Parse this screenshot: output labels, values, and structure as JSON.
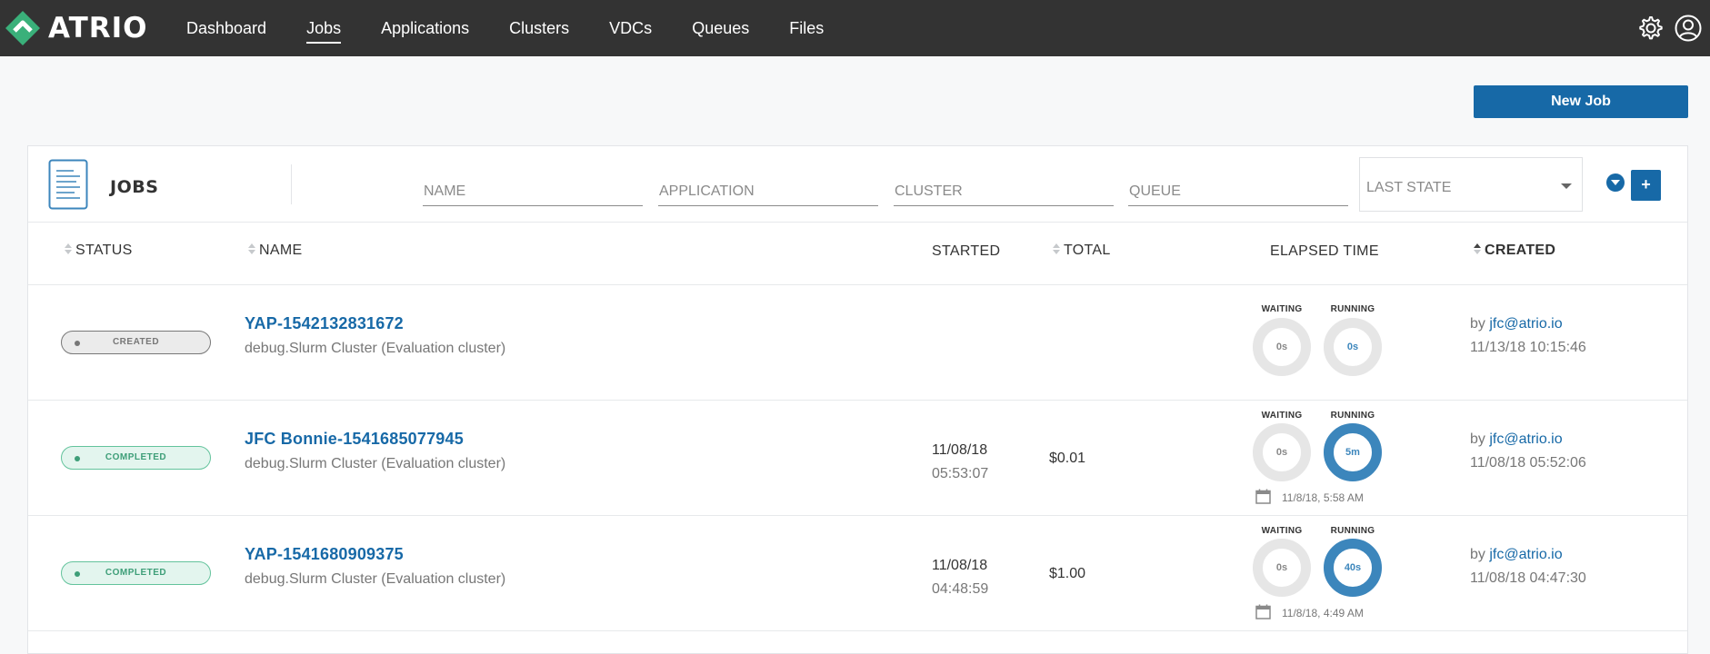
{
  "nav": {
    "logo_text": "ATRIO",
    "links": [
      "Dashboard",
      "Jobs",
      "Applications",
      "Clusters",
      "VDCs",
      "Queues",
      "Files"
    ],
    "active": "Jobs",
    "icons": [
      "gear-icon",
      "user-icon"
    ]
  },
  "actions": {
    "new_job_label": "New Job"
  },
  "jobs_panel": {
    "title": "JOBS",
    "filters": {
      "name_placeholder": "NAME",
      "application_placeholder": "APPLICATION",
      "cluster_placeholder": "CLUSTER",
      "queue_placeholder": "QUEUE",
      "state_placeholder": "LAST STATE"
    },
    "add_button": "+"
  },
  "table": {
    "headers": {
      "status": "STATUS",
      "name": "NAME",
      "started": "STARTED",
      "total": "TOTAL",
      "elapsed": "ELAPSED TIME",
      "created": "CREATED"
    },
    "gauge_labels": {
      "waiting": "WAITING",
      "running": "RUNNING"
    },
    "rows": [
      {
        "status": "CREATED",
        "name": "YAP-1542132831672",
        "subtitle": "debug.Slurm Cluster (Evaluation cluster)",
        "started_date": "",
        "started_time": "",
        "total": "",
        "waiting": "0s",
        "running": "0s",
        "running_active": false,
        "end_time": "",
        "created_by_prefix": "by",
        "created_by": "jfc@atrio.io",
        "created_at": "11/13/18 10:15:46"
      },
      {
        "status": "COMPLETED",
        "name": "JFC Bonnie-1541685077945",
        "subtitle": "debug.Slurm Cluster (Evaluation cluster)",
        "started_date": "11/08/18",
        "started_time": "05:53:07",
        "total": "$0.01",
        "waiting": "0s",
        "running": "5m",
        "running_active": true,
        "end_time": "11/8/18, 5:58 AM",
        "created_by_prefix": "by",
        "created_by": "jfc@atrio.io",
        "created_at": "11/08/18 05:52:06"
      },
      {
        "status": "COMPLETED",
        "name": "YAP-1541680909375",
        "subtitle": "debug.Slurm Cluster (Evaluation cluster)",
        "started_date": "11/08/18",
        "started_time": "04:48:59",
        "total": "$1.00",
        "waiting": "0s",
        "running": "40s",
        "running_active": true,
        "end_time": "11/8/18, 4:49 AM",
        "created_by_prefix": "by",
        "created_by": "jfc@atrio.io",
        "created_at": "11/08/18 04:47:30"
      }
    ]
  },
  "colors": {
    "topbar": "#333333",
    "accent": "#1769a7",
    "logo_green": "#3ab07a",
    "completed_green": "#3e9e78",
    "gauge_active": "#3c86bc",
    "gauge_idle": "#e6e6e6"
  }
}
